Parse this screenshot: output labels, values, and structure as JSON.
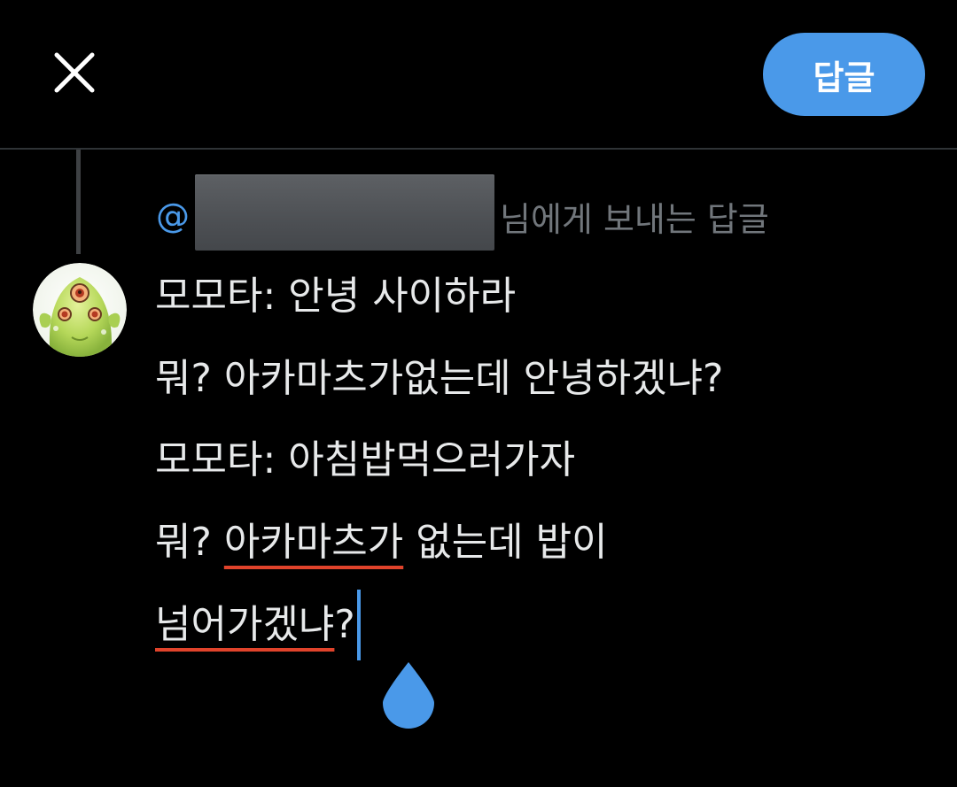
{
  "header": {
    "close_icon": "close-icon",
    "reply_button_label": "답글",
    "accent_color": "#4a99e9"
  },
  "reply_context": {
    "at_symbol": "@",
    "suffix": "님에게 보내는 답글"
  },
  "compose": {
    "lines": [
      "모모타: 안녕 사이하라",
      "뭐? 아카마츠가없는데 안녕하겠냐?",
      "모모타: 아침밥먹으러가자"
    ],
    "line4_prefix": "뭐? ",
    "line4_misspelled": "아카마츠가",
    "line4_suffix": " 없는데 밥이",
    "line5_misspelled": "넘어가겠냐",
    "line5_suffix": "?"
  },
  "avatar": {
    "icon": "avatar-green-creature-icon"
  },
  "colors": {
    "background": "#000000",
    "text": "#e7e9ea",
    "muted": "#71767b",
    "spellcheck_underline": "#e0432b"
  }
}
